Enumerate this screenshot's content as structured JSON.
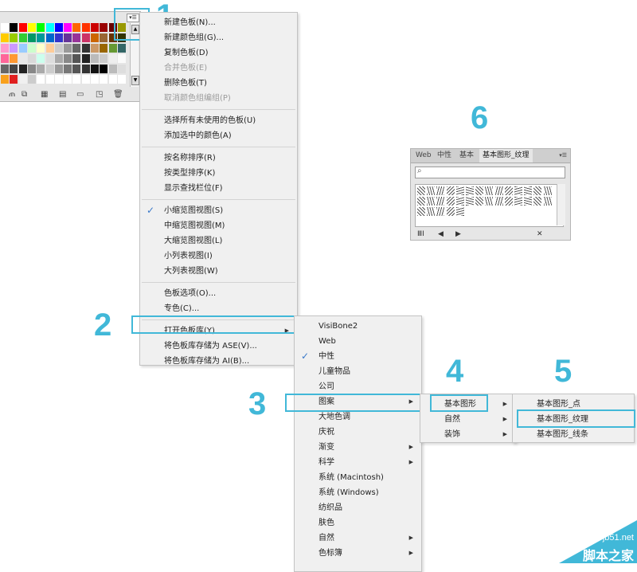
{
  "colors": {
    "accent": "#41b8d8",
    "check": "#3a79c9",
    "menu_bg": "#f0f0f0",
    "panel_bg": "#e6e6e6"
  },
  "steps": [
    "1",
    "2",
    "3",
    "4",
    "5",
    "6"
  ],
  "main_menu": {
    "items": [
      {
        "label": "新建色板(N)..."
      },
      {
        "label": "新建颜色组(G)..."
      },
      {
        "label": "复制色板(D)"
      },
      {
        "label": "合并色板(E)",
        "disabled": true
      },
      {
        "label": "删除色板(T)"
      },
      {
        "label": "取消颜色组编组(P)",
        "disabled": true
      },
      {
        "label": "选择所有未使用的色板(U)"
      },
      {
        "label": "添加选中的颜色(A)"
      },
      {
        "label": "按名称排序(R)"
      },
      {
        "label": "按类型排序(K)"
      },
      {
        "label": "显示查找栏位(F)"
      },
      {
        "label": "小缩览图视图(S)",
        "checked": true
      },
      {
        "label": "中缩览图视图(M)"
      },
      {
        "label": "大缩览图视图(L)"
      },
      {
        "label": "小列表视图(I)"
      },
      {
        "label": "大列表视图(W)"
      },
      {
        "label": "色板选项(O)..."
      },
      {
        "label": "专色(C)..."
      },
      {
        "label": "打开色板库(Y)",
        "submenu": true
      },
      {
        "label": "将色板库存储为 ASE(V)..."
      },
      {
        "label": "将色板库存储为 AI(B)..."
      }
    ]
  },
  "library_menu": {
    "items": [
      {
        "label": "VisiBone2"
      },
      {
        "label": "Web"
      },
      {
        "label": "中性",
        "checked": true
      },
      {
        "label": "儿童物品"
      },
      {
        "label": "公司"
      },
      {
        "label": "图案",
        "submenu": true
      },
      {
        "label": "大地色调"
      },
      {
        "label": "庆祝"
      },
      {
        "label": "渐变",
        "submenu": true
      },
      {
        "label": "科学",
        "submenu": true
      },
      {
        "label": "系统 (Macintosh)"
      },
      {
        "label": "系统 (Windows)"
      },
      {
        "label": "纺织品"
      },
      {
        "label": "肤色"
      },
      {
        "label": "自然",
        "submenu": true
      },
      {
        "label": "色标簿",
        "submenu": true
      }
    ]
  },
  "pattern_menu": {
    "items": [
      {
        "label": "基本图形"
      },
      {
        "label": "自然"
      },
      {
        "label": "装饰"
      }
    ]
  },
  "basic_menu": {
    "items": [
      {
        "label": "基本图形_点"
      },
      {
        "label": "基本图形_纹理"
      },
      {
        "label": "基本图形_线条"
      }
    ]
  },
  "lib_panel": {
    "tabs": [
      "Web",
      "中性",
      "基本",
      "基本图形_纹理"
    ],
    "search_icon": "search-icon",
    "bottom_icons": [
      "library-icon",
      "prev-arrow-icon",
      "next-arrow-icon",
      "unlink-icon"
    ]
  },
  "swatch_panel": {
    "icons": [
      "menu-icon",
      "scroll-up-icon",
      "scroll-down-icon"
    ],
    "bottom_icons": [
      "library-menu-icon",
      "show-kinds-icon",
      "swatch-options-icon",
      "color-group-icon",
      "new-group-icon",
      "new-swatch-icon",
      "delete-icon"
    ]
  },
  "watermark": {
    "line1": "jb51.net",
    "line2": "脚本之家"
  }
}
